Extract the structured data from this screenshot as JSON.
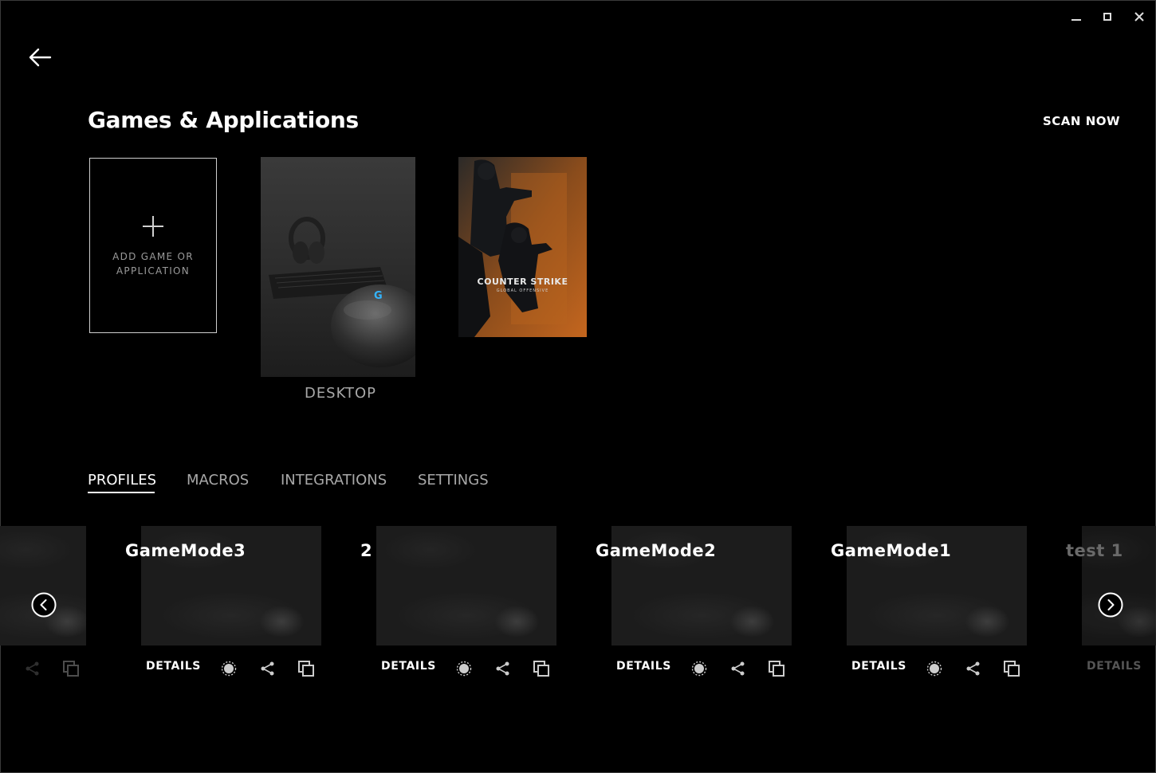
{
  "header": {
    "title": "Games & Applications",
    "scan_label": "SCAN NOW"
  },
  "window_controls": {
    "minimize": "minimize-icon",
    "maximize": "maximize-icon",
    "close": "close-icon",
    "close_glyph": "✕"
  },
  "games": {
    "add_label_line1": "ADD GAME OR",
    "add_label_line2": "APPLICATION",
    "desktop_name": "DESKTOP",
    "cs_logo_text": "COUNTER STRIKE",
    "cs_logo_sub": "GLOBAL OFFENSIVE"
  },
  "tabs": [
    {
      "label": "PROFILES",
      "active": true
    },
    {
      "label": "MACROS",
      "active": false
    },
    {
      "label": "INTEGRATIONS",
      "active": false
    },
    {
      "label": "SETTINGS",
      "active": false
    }
  ],
  "profiles": [
    {
      "name": "GameMode3",
      "details_label": "DETAILS"
    },
    {
      "name": "2",
      "details_label": "DETAILS"
    },
    {
      "name": "GameMode2",
      "details_label": "DETAILS"
    },
    {
      "name": "GameMode1",
      "details_label": "DETAILS"
    },
    {
      "name": "test 1",
      "details_label": "DETAILS"
    }
  ],
  "colors": {
    "background": "#000000",
    "text_primary": "#ffffff",
    "text_secondary": "#a8a8a8",
    "desktop_g_logo": "#33b5ff",
    "cs_orange": "#c4661e"
  }
}
